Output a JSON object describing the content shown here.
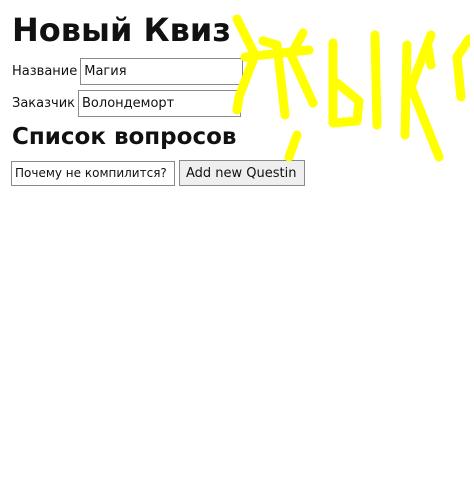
{
  "page": {
    "title": "Новый Квиз"
  },
  "form": {
    "name_label": "Название",
    "name_value": "Магия",
    "client_label": "Заказчик",
    "client_value": "Волондеморт"
  },
  "questions": {
    "heading": "Список вопросов",
    "new_question_value": "Почему не компилится?",
    "add_button_label": "Add new Questin"
  },
  "scribble": {
    "color": "#ffff00"
  }
}
